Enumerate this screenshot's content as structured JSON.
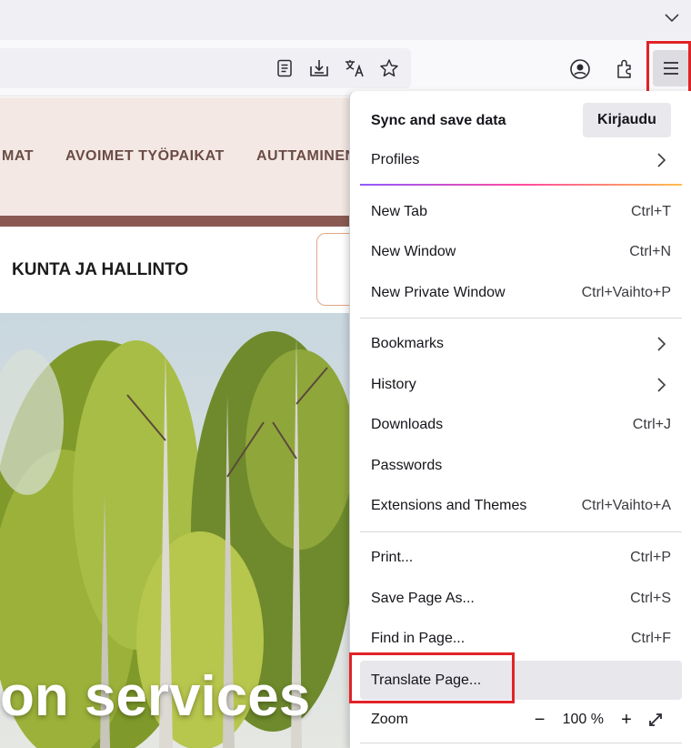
{
  "page": {
    "nav_links": [
      "MAT",
      "AVOIMET TYÖPAIKAT",
      "AUTTAMINEN"
    ],
    "section_title": "KUNTA JA HALLINTO",
    "hero_heading": "on services"
  },
  "toolbar": {
    "icons": [
      "reader-view-icon",
      "save-to-pocket-icon",
      "translate-icon",
      "bookmark-star-icon",
      "account-icon",
      "extensions-icon",
      "menu-icon",
      "tab-list-chevron-icon"
    ]
  },
  "app_menu": {
    "sync_label": "Sync and save data",
    "signin_label": "Kirjaudu",
    "profiles": "Profiles",
    "new_tab": {
      "label": "New Tab",
      "shortcut": "Ctrl+T"
    },
    "new_window": {
      "label": "New Window",
      "shortcut": "Ctrl+N"
    },
    "new_private": {
      "label": "New Private Window",
      "shortcut": "Ctrl+Vaihto+P"
    },
    "bookmarks": "Bookmarks",
    "history": "History",
    "downloads": {
      "label": "Downloads",
      "shortcut": "Ctrl+J"
    },
    "passwords": "Passwords",
    "extensions": {
      "label": "Extensions and Themes",
      "shortcut": "Ctrl+Vaihto+A"
    },
    "print": {
      "label": "Print...",
      "shortcut": "Ctrl+P"
    },
    "save_page": {
      "label": "Save Page As...",
      "shortcut": "Ctrl+S"
    },
    "find": {
      "label": "Find in Page...",
      "shortcut": "Ctrl+F"
    },
    "translate": "Translate Page...",
    "zoom": {
      "label": "Zoom",
      "minus": "−",
      "value": "100 %",
      "plus": "+"
    }
  },
  "colors": {
    "highlight": "#e02328",
    "site_nav_bg": "#f3e8e4",
    "site_band": "#8a5a52",
    "nav_link": "#6b4b45"
  }
}
